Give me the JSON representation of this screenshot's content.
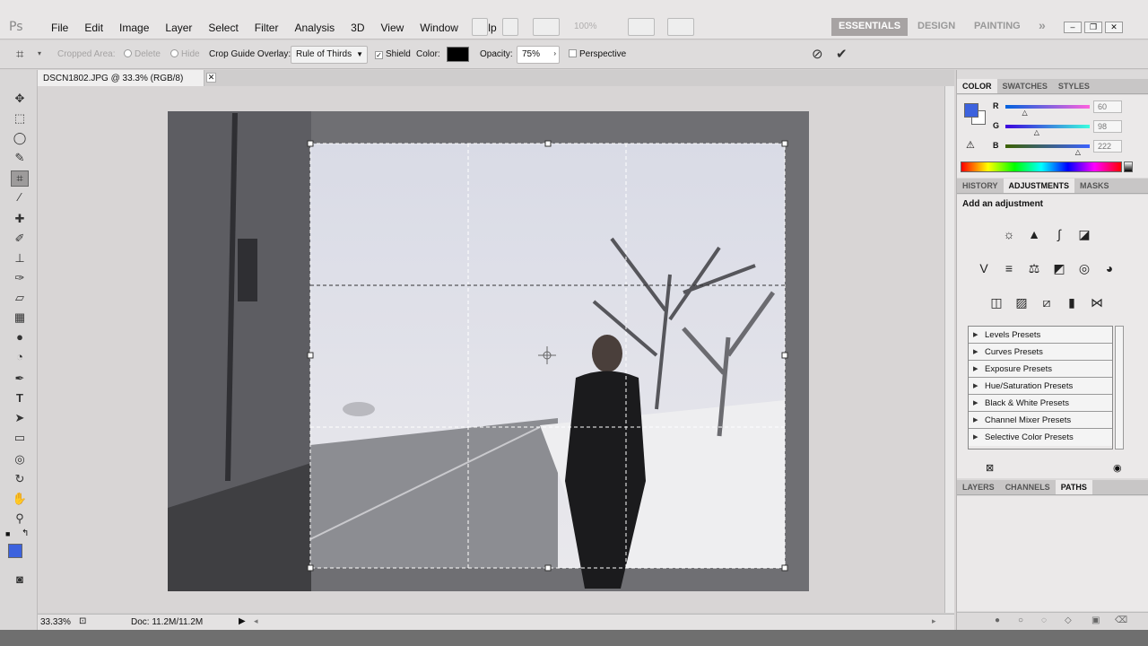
{
  "app": {
    "logo": "Ps",
    "menu": [
      "File",
      "Edit",
      "Image",
      "Layer",
      "Select",
      "Filter",
      "Analysis",
      "3D",
      "View",
      "Window",
      "Help"
    ],
    "zoom_dropdown": "100%",
    "workspaces": [
      "ESSENTIALS",
      "DESIGN",
      "PAINTING"
    ],
    "workspace_more": "»"
  },
  "options": {
    "cropped_area": "Cropped Area:",
    "delete": "Delete",
    "hide": "Hide",
    "overlay_label": "Crop Guide Overlay:",
    "overlay_value": "Rule of Thirds",
    "shield": "Shield",
    "color_label": "Color:",
    "opacity_label": "Opacity:",
    "opacity_value": "75%",
    "perspective": "Perspective",
    "shield_color": "#000000"
  },
  "document": {
    "tab": "DSCN1802.JPG @ 33.3% (RGB/8)",
    "zoom": "33.33%",
    "doc_size": "Doc: 11.2M/11.2M"
  },
  "color_panel": {
    "tabs": [
      "COLOR",
      "SWATCHES",
      "STYLES"
    ],
    "r": "60",
    "g": "98",
    "b": "222",
    "fg_color": "#3c62de",
    "r_level": 0.24,
    "g_level": 0.38,
    "b_level": 0.87
  },
  "adjustments_panel": {
    "tabs": [
      "HISTORY",
      "ADJUSTMENTS",
      "MASKS"
    ],
    "heading": "Add an adjustment",
    "presets": [
      "Levels Presets",
      "Curves Presets",
      "Exposure Presets",
      "Hue/Saturation Presets",
      "Black & White Presets",
      "Channel Mixer Presets",
      "Selective Color Presets"
    ]
  },
  "layers_panel": {
    "tabs": [
      "LAYERS",
      "CHANNELS",
      "PATHS"
    ]
  }
}
